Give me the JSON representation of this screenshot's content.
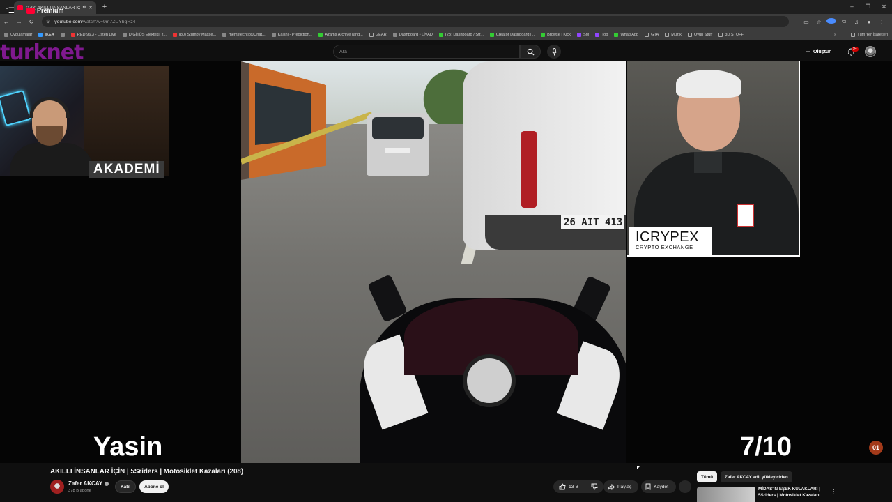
{
  "browser": {
    "tab_title": "(148) AKILLI İNSANLAR İÇİN",
    "url_domain": "youtube.com",
    "url_path": "/watch?v=9m7ZUYbgRz4",
    "window_controls": [
      "–",
      "❐",
      "✕"
    ]
  },
  "bookmarks": {
    "items": [
      {
        "label": "Uygulamalar",
        "icon": "apps-grid-icon"
      },
      {
        "label": "IKEA",
        "icon": "ikea-icon"
      },
      {
        "label": "",
        "icon": "grid-icon"
      },
      {
        "label": "RED 96.3 - Listen Live",
        "icon": "radio-icon"
      },
      {
        "label": "DİGİTÜS Elektrikli Y...",
        "icon": "digitus-icon"
      },
      {
        "label": "(80) Stumpy Masse...",
        "icon": "youtube-icon"
      },
      {
        "label": "memstechtips/Unat...",
        "icon": "github-icon"
      },
      {
        "label": "Kalshi - Prediction...",
        "icon": "kalshi-icon"
      },
      {
        "label": "Azams Archive (and...",
        "icon": "sheets-icon"
      },
      {
        "label": "GEAR",
        "icon": "folder-icon"
      },
      {
        "label": "Dashboard • LİVAD",
        "icon": "livad-icon"
      },
      {
        "label": "(23) Dashboard / Str...",
        "icon": "stream-icon"
      },
      {
        "label": "Creator Dashboard |...",
        "icon": "kick-icon"
      },
      {
        "label": "Browse | Kick",
        "icon": "kick-icon"
      },
      {
        "label": "SM",
        "icon": "twitch-icon"
      },
      {
        "label": "Top",
        "icon": "twitch-icon"
      },
      {
        "label": "WhatsApp",
        "icon": "whatsapp-icon"
      },
      {
        "label": "GTA",
        "icon": "folder-icon"
      },
      {
        "label": "Müzik",
        "icon": "folder-icon"
      },
      {
        "label": "Oyun Stuff",
        "icon": "folder-icon"
      },
      {
        "label": "3D STUFF",
        "icon": "folder-icon"
      }
    ],
    "overflow": "»",
    "all_bookmarks": "Tüm Yer İşaretleri"
  },
  "youtube_header": {
    "logo_text": "Premium",
    "overlay_brand": "turknet",
    "search_placeholder": "Ara",
    "create_label": "Oluştur",
    "notification_count": "9+"
  },
  "video": {
    "left_label": "AKADEMİ",
    "bottom_left_name": "Yasin",
    "counter": "7/10",
    "plate_text": "26 AIT 413",
    "ad_brand": "ICRYPEX",
    "ad_sub": "CRYPTO EXCHANGE",
    "corner_badge": "01"
  },
  "below_video": {
    "title": "AKILLI İNSANLAR İÇİN | 5Sriders | Motosiklet Kazaları (208)",
    "channel_name": "Zafer AKCAY",
    "subscribers": "378 B abone",
    "join_label": "Katıl",
    "subscribe_label": "Abone ol",
    "like_count": "13 B",
    "share_label": "Paylaş",
    "save_label": "Kaydet"
  },
  "recommendations": {
    "chips": [
      "Tümü",
      "Zafer AKCAY adlı yükleyiciden"
    ],
    "first_title": "MİDAS'IN EŞEK KULAKLARI | 5Sriders | Motosiklet Kazaları ..."
  }
}
